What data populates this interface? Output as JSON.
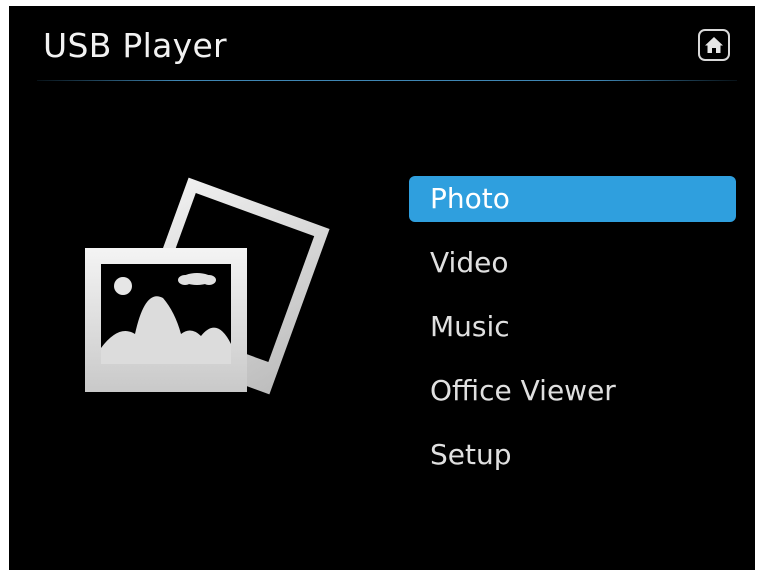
{
  "header": {
    "title": "USB Player",
    "home_icon": "home-icon"
  },
  "hero": {
    "icon": "photo-stack-icon"
  },
  "menu": {
    "selected_index": 0,
    "items": [
      {
        "label": "Photo"
      },
      {
        "label": "Video"
      },
      {
        "label": "Music"
      },
      {
        "label": "Office Viewer"
      },
      {
        "label": "Setup"
      }
    ]
  },
  "colors": {
    "background": "#000000",
    "accent": "#2f9fde",
    "divider": "#3f86b3",
    "text": "#e0e0e0"
  }
}
